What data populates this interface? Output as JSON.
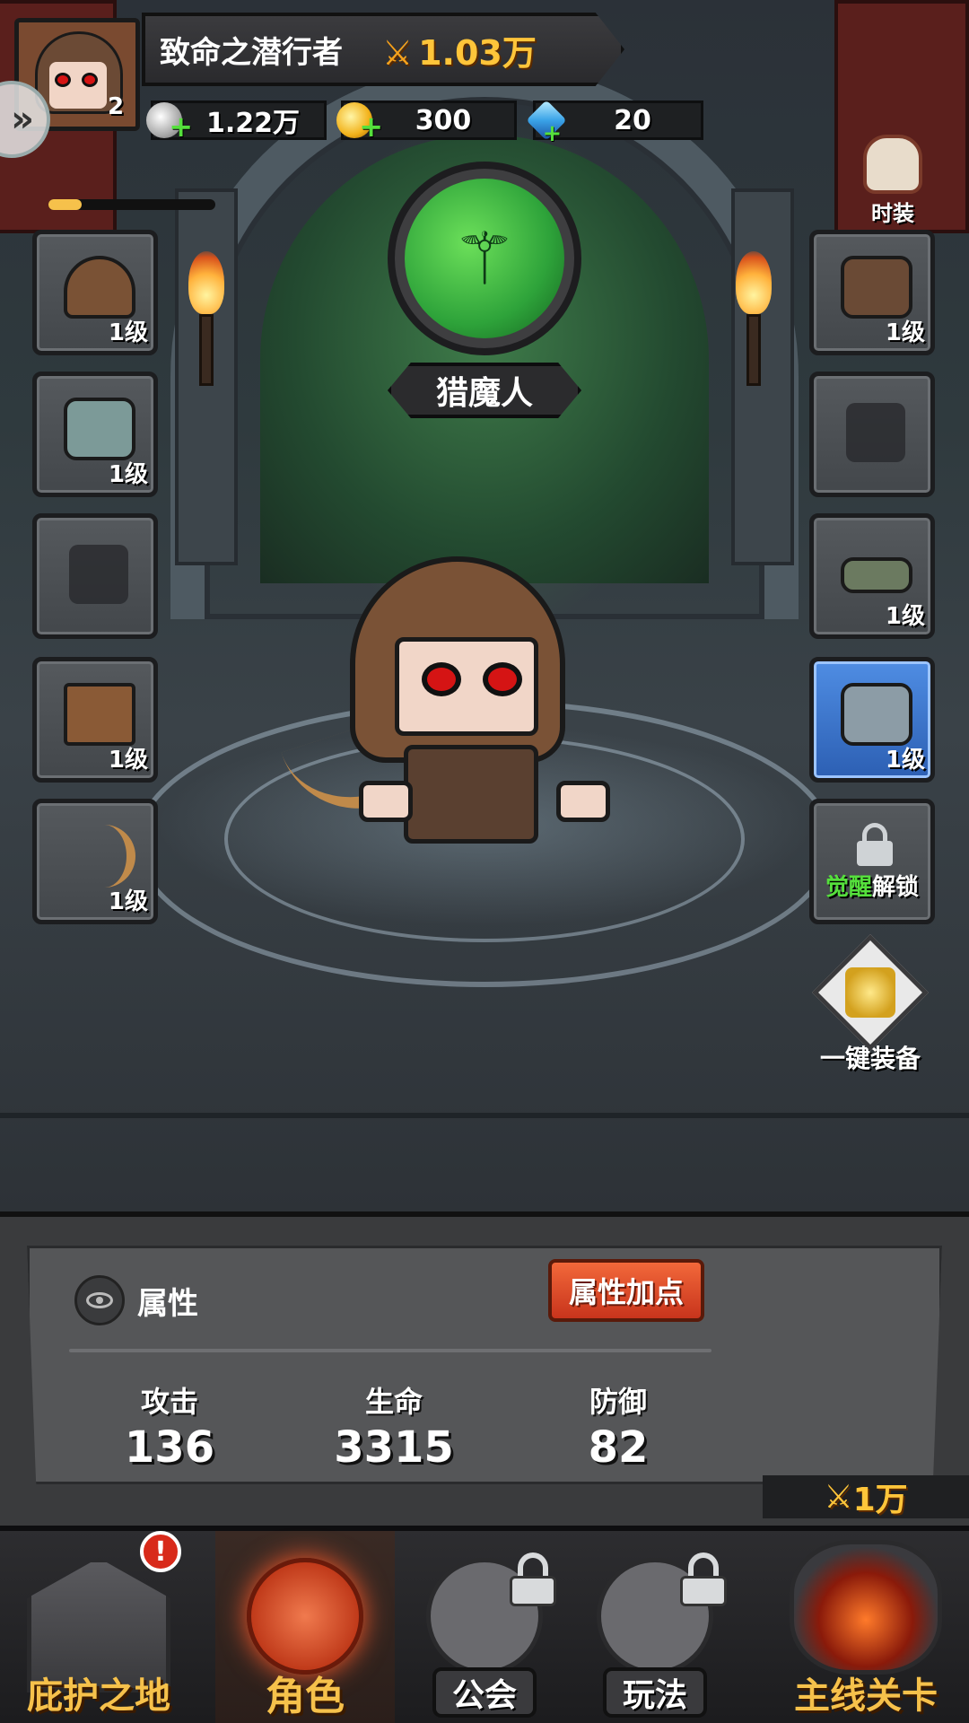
{
  "player": {
    "name": "致命之潜行者",
    "level": "2",
    "power": "1.03万",
    "xp_progress": 0.2
  },
  "currencies": {
    "silver": "1.22万",
    "gold": "300",
    "gems": "20"
  },
  "costume": {
    "label": "时装"
  },
  "hero_class": {
    "name": "猎魔人"
  },
  "equipment": {
    "left": [
      {
        "slot": "helmet",
        "level": "1级"
      },
      {
        "slot": "mask",
        "level": "1级"
      },
      {
        "slot": "empty",
        "level": ""
      },
      {
        "slot": "pants",
        "level": "1级"
      },
      {
        "slot": "bow",
        "level": "1级"
      }
    ],
    "right": [
      {
        "slot": "armor",
        "level": "1级"
      },
      {
        "slot": "empty",
        "level": ""
      },
      {
        "slot": "belt",
        "level": "1级"
      },
      {
        "slot": "gloves",
        "level": "1级"
      }
    ],
    "awaken_lock": {
      "part1": "觉醒",
      "part2": "解锁"
    },
    "one_key_equip": "一键装备"
  },
  "attributes": {
    "title": "属性",
    "add_points_button": "属性加点",
    "stats": [
      {
        "label": "攻击",
        "value": "136"
      },
      {
        "label": "生命",
        "value": "3315"
      },
      {
        "label": "防御",
        "value": "82"
      }
    ]
  },
  "stage_power": "1万",
  "nav": {
    "home": "庇护之地",
    "role": "角色",
    "guild": "公会",
    "play": "玩法",
    "stage": "主线关卡",
    "alert_mark": "!"
  },
  "icons": {
    "power": "crossed-swords-icon",
    "silver": "silver-coin-icon",
    "gold": "gold-coin-icon",
    "gem": "blue-gem-icon",
    "plus": "green-plus-icon",
    "lock": "lock-icon",
    "eye": "eye-icon"
  },
  "colors": {
    "accent_gold": "#ffc53a",
    "button_red": "#e0502a",
    "plus_green": "#55e03c",
    "selected_blue": "#3f7bd6",
    "emblem_green": "#2ea33a"
  }
}
